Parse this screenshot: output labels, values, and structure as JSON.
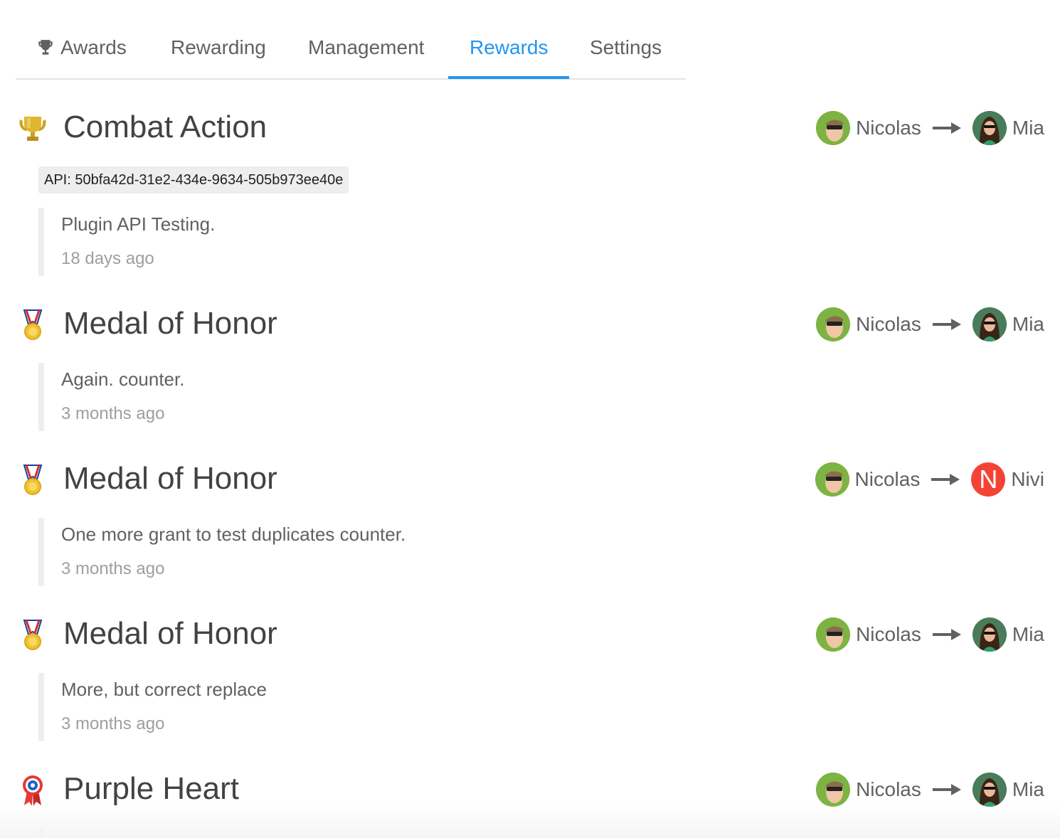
{
  "tabs": [
    {
      "label": "Awards",
      "icon": "trophy-icon"
    },
    {
      "label": "Rewarding"
    },
    {
      "label": "Management"
    },
    {
      "label": "Rewards",
      "active": true
    },
    {
      "label": "Settings"
    }
  ],
  "colors": {
    "accent": "#2196f3",
    "nivi_avatar": "#f44336",
    "nicolas_avatar": "#7cb342",
    "mia_avatar": "#2e7d5b"
  },
  "entries": [
    {
      "title": "Combat Action",
      "icon": "trophy-gold-icon",
      "api": "API: 50bfa42d-31e2-434e-9634-505b973ee40e",
      "giver": "Nicolas",
      "receiver": "Mia",
      "message": "Plugin API Testing.",
      "time": "18 days ago"
    },
    {
      "title": "Medal of Honor",
      "icon": "medal-icon",
      "giver": "Nicolas",
      "receiver": "Mia",
      "message": "Again. counter.",
      "time": "3 months ago"
    },
    {
      "title": "Medal of Honor",
      "icon": "medal-icon",
      "giver": "Nicolas",
      "receiver": "Nivi",
      "receiver_initial": "N",
      "message": "One more grant to test duplicates counter.",
      "time": "3 months ago"
    },
    {
      "title": "Medal of Honor",
      "icon": "medal-icon",
      "giver": "Nicolas",
      "receiver": "Mia",
      "message": "More, but correct replace",
      "time": "3 months ago"
    },
    {
      "title": "Purple Heart",
      "icon": "rosette-icon",
      "giver": "Nicolas",
      "receiver": "Mia"
    }
  ]
}
